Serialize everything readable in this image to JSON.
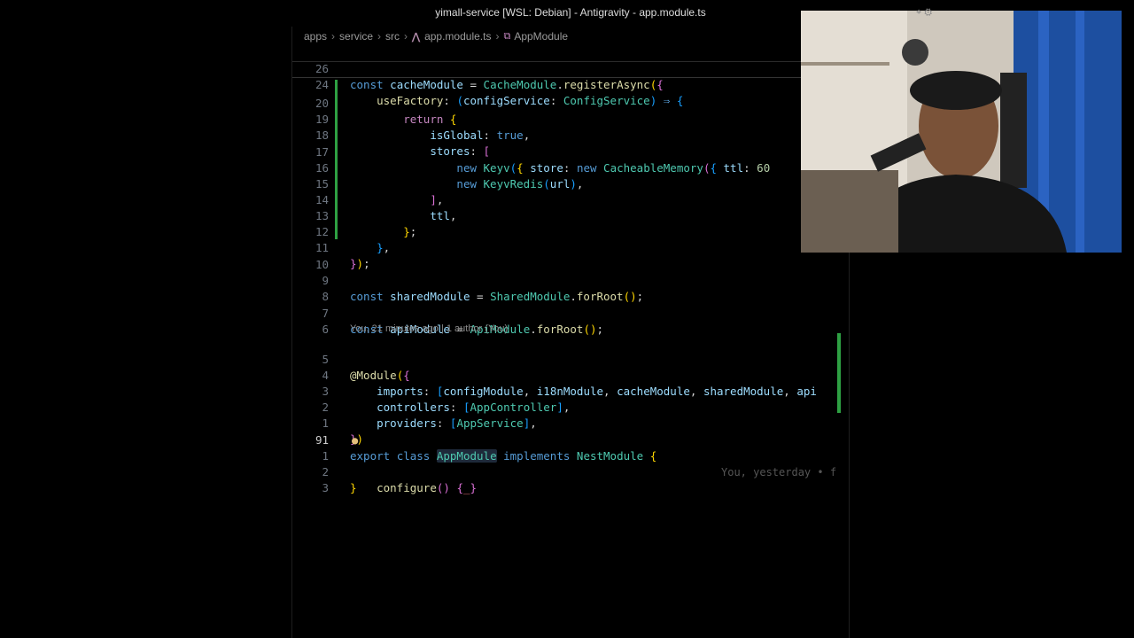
{
  "window": {
    "title": "yimall-service [WSL: Debian] - Antigravity - app.module.ts"
  },
  "breadcrumb": {
    "items": [
      "apps",
      "service",
      "src"
    ],
    "file": "app.module.ts",
    "symbol": "AppModule"
  },
  "codelens": {
    "text": "You, 21 minutes ago | 1 author (You)"
  },
  "blame": {
    "text": "You, yesterday • f"
  },
  "line_numbers": [
    "26",
    "24",
    "20",
    "19",
    "18",
    "17",
    "16",
    "15",
    "14",
    "13",
    "12",
    "11",
    "10",
    "9",
    "8",
    "7",
    "6",
    "5",
    "4",
    "3",
    "2",
    "1",
    "91",
    "1",
    "2",
    "3"
  ],
  "colors": {
    "modified_gutter": "#2ea043",
    "background": "#000000",
    "keyword": "#569cd6",
    "type": "#4ec9b0"
  },
  "icons": [
    "file-ts-icon",
    "symbol-class-icon",
    "lightbulb-icon"
  ]
}
